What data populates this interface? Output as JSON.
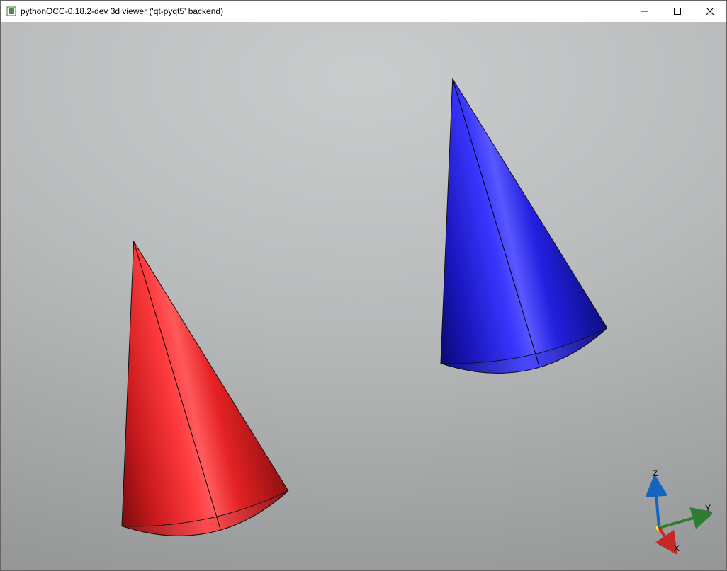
{
  "window": {
    "title": "pythonOCC-0.18.2-dev 3d viewer ('qt-pyqt5' backend)"
  },
  "scene": {
    "shapes": [
      {
        "type": "cone",
        "color": "#ed1c24",
        "name": "red-cone"
      },
      {
        "type": "cone",
        "color": "#1a17d6",
        "name": "blue-cone"
      }
    ]
  },
  "trihedron": {
    "axes": {
      "x": {
        "label": "X",
        "color": "#c62828"
      },
      "y": {
        "label": "Y",
        "color": "#2e7d32"
      },
      "z": {
        "label": "Z",
        "color": "#1565c0"
      }
    }
  },
  "icons": {
    "app": "app-icon"
  }
}
